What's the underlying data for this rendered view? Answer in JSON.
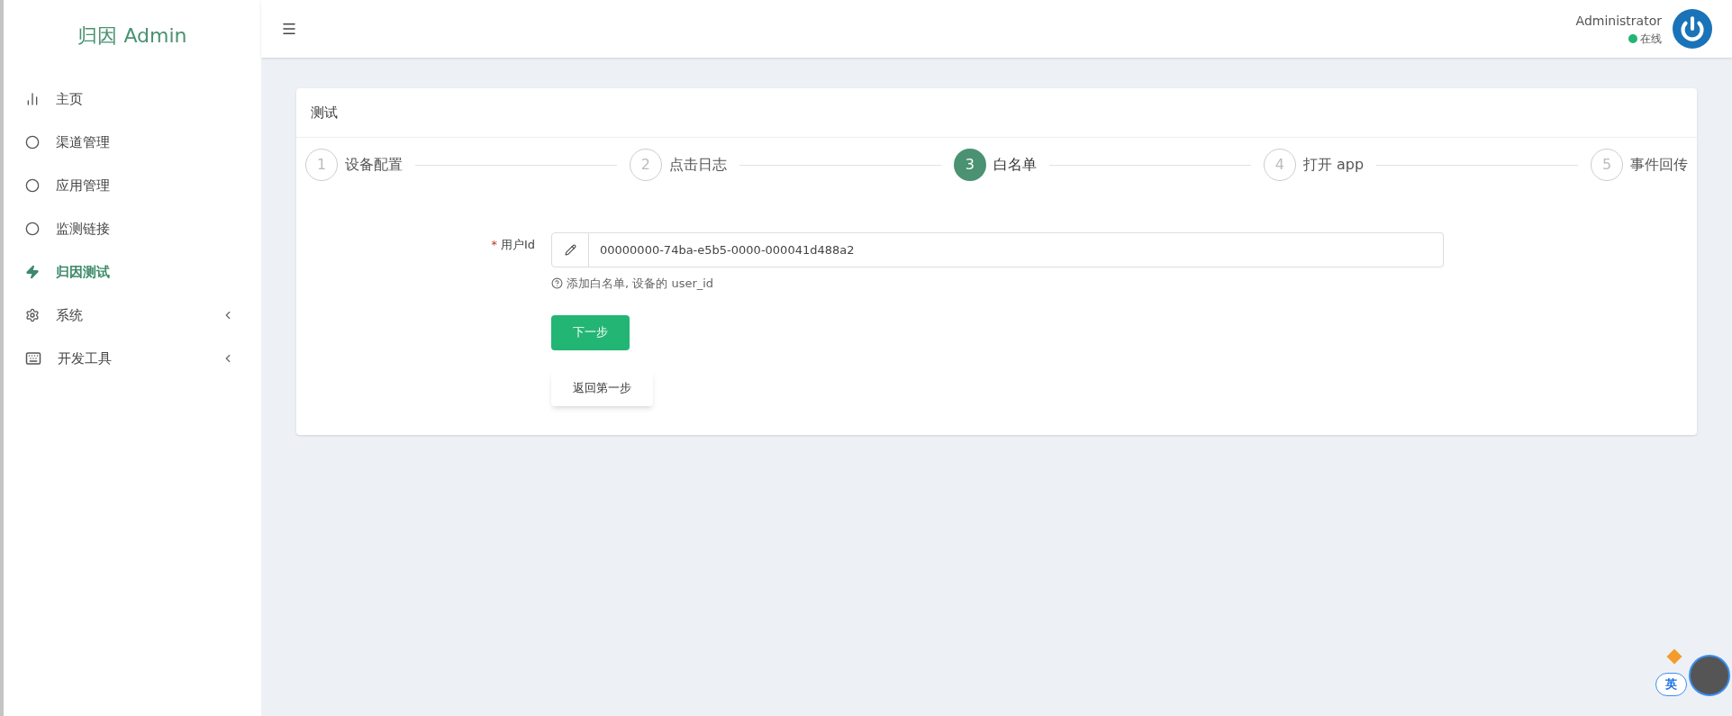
{
  "sidebar": {
    "logo": "归因 Admin",
    "items": [
      {
        "label": "主页",
        "selected": false,
        "has_submenu": false
      },
      {
        "label": "渠道管理",
        "selected": false,
        "has_submenu": false
      },
      {
        "label": "应用管理",
        "selected": false,
        "has_submenu": false
      },
      {
        "label": "监测链接",
        "selected": false,
        "has_submenu": false
      },
      {
        "label": "归因测试",
        "selected": true,
        "has_submenu": false
      },
      {
        "label": "系统",
        "selected": false,
        "has_submenu": true
      },
      {
        "label": "开发工具",
        "selected": false,
        "has_submenu": true
      }
    ]
  },
  "header": {
    "user": "Administrator",
    "status": "在线"
  },
  "card": {
    "title": "测试",
    "steps": [
      {
        "number": "1",
        "label": "设备配置",
        "selected": false
      },
      {
        "number": "2",
        "label": "点击日志",
        "selected": false
      },
      {
        "number": "3",
        "label": "白名单",
        "selected": true
      },
      {
        "number": "4",
        "label": "打开 app",
        "selected": false
      },
      {
        "number": "5",
        "label": "事件回传",
        "selected": false
      }
    ],
    "form": {
      "required_mark": "*",
      "label": "用户Id",
      "value": "00000000-74ba-e5b5-0000-000041d488a2",
      "help": "添加白名单, 设备的 user_id"
    },
    "buttons": [
      {
        "kind": "primary",
        "label": "下一步"
      },
      {
        "kind": "default",
        "label": "返回第一步"
      }
    ]
  },
  "ime": {
    "label": "英"
  }
}
